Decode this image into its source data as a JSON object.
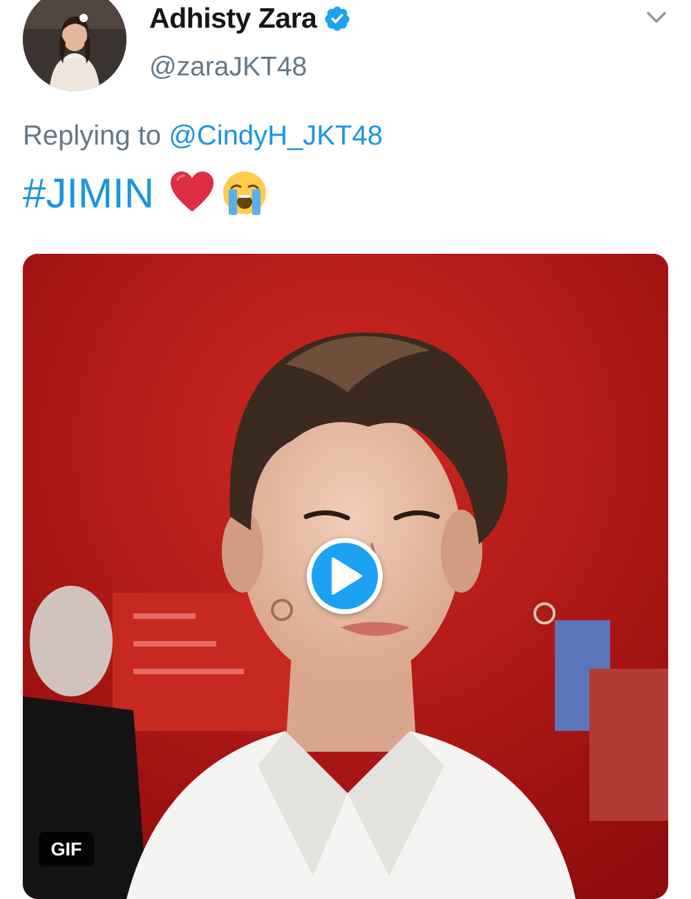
{
  "tweet": {
    "display_name": "Adhisty Zara",
    "handle": "@zaraJKT48",
    "verified": true,
    "reply_prefix": "Replying to",
    "reply_to": "@CindyH_JKT48",
    "hashtag": "#JIMIN",
    "emojis": [
      "red-heart-emoji",
      "loudly-crying-face-emoji"
    ],
    "media": {
      "type": "gif",
      "badge": "GIF",
      "play_icon": "play-icon"
    }
  },
  "colors": {
    "link": "#1b95e0",
    "secondary_text": "#657786",
    "play_button": "#1da1f2",
    "media_background": "#b21515"
  }
}
